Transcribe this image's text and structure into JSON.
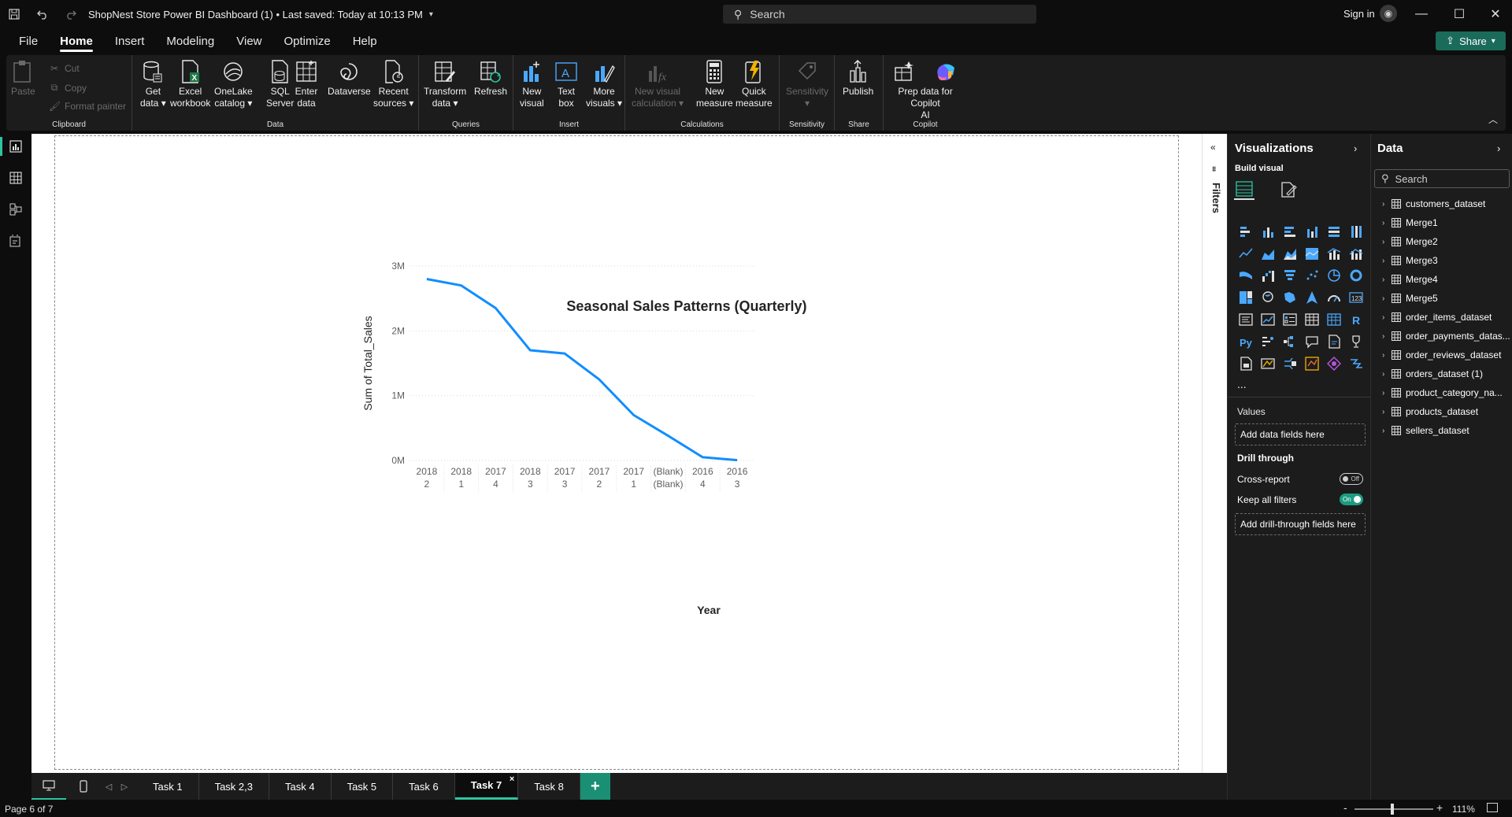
{
  "titlebar": {
    "title": "ShopNest Store Power BI Dashboard (1) • Last saved: Today at 10:13 PM",
    "search_placeholder": "Search",
    "signin": "Sign in"
  },
  "menu": {
    "tabs": [
      "File",
      "Home",
      "Insert",
      "Modeling",
      "View",
      "Optimize",
      "Help"
    ],
    "active": "Home",
    "share_label": "Share"
  },
  "ribbon": {
    "clipboard": {
      "label": "Clipboard",
      "paste": "Paste",
      "cut": "Cut",
      "copy": "Copy",
      "format_painter": "Format painter"
    },
    "data": {
      "label": "Data",
      "get_data": [
        "Get",
        "data"
      ],
      "excel": [
        "Excel",
        "workbook"
      ],
      "onelake": [
        "OneLake",
        "catalog"
      ],
      "sql": [
        "SQL",
        "Server"
      ],
      "enter": [
        "Enter",
        "data"
      ],
      "dataverse": [
        "Dataverse",
        ""
      ],
      "recent": [
        "Recent",
        "sources"
      ]
    },
    "queries": {
      "label": "Queries",
      "transform": [
        "Transform",
        "data"
      ],
      "refresh": [
        "Refresh",
        ""
      ]
    },
    "insert": {
      "label": "Insert",
      "new_visual": [
        "New",
        "visual"
      ],
      "text_box": [
        "Text",
        "box"
      ],
      "more_visuals": [
        "More",
        "visuals"
      ]
    },
    "calculations": {
      "label": "Calculations",
      "new_visual_calc": [
        "New visual",
        "calculation"
      ],
      "new_measure": [
        "New",
        "measure"
      ],
      "quick_measure": [
        "Quick",
        "measure"
      ]
    },
    "sensitivity": {
      "label": "Sensitivity",
      "sensitivity": [
        "Sensitivity",
        ""
      ]
    },
    "share": {
      "label": "Share",
      "publish": [
        "Publish",
        ""
      ]
    },
    "copilot": {
      "label": "Copilot",
      "prep": [
        "Prep data for Copilot",
        "AI"
      ]
    }
  },
  "chart_data": {
    "type": "line",
    "title": "Seasonal Sales Patterns (Quarterly)",
    "xlabel": "Year",
    "ylabel": "Sum of Total_Sales",
    "categories": [
      [
        "2018",
        "2"
      ],
      [
        "2018",
        "1"
      ],
      [
        "2017",
        "4"
      ],
      [
        "2018",
        "3"
      ],
      [
        "2017",
        "3"
      ],
      [
        "2017",
        "2"
      ],
      [
        "2017",
        "1"
      ],
      [
        "(Blank)",
        "(Blank)"
      ],
      [
        "2016",
        "4"
      ],
      [
        "2016",
        "3"
      ]
    ],
    "values": [
      2800000,
      2700000,
      2350000,
      1700000,
      1650000,
      1250000,
      700000,
      380000,
      50000,
      5000
    ],
    "yticks": [
      "0M",
      "1M",
      "2M",
      "3M"
    ],
    "ylim": [
      0,
      3000000
    ],
    "line_color": "#118DFF",
    "grid": true
  },
  "filters_label": "Filters",
  "visualizations": {
    "title": "Visualizations",
    "build_visual": "Build visual",
    "more": "...",
    "values_label": "Values",
    "values_placeholder": "Add data fields here",
    "drill_through": "Drill through",
    "cross_report": "Cross-report",
    "cross_report_state": "Off",
    "keep_all_filters": "Keep all filters",
    "keep_all_filters_state": "On",
    "drill_placeholder": "Add drill-through fields here"
  },
  "data_pane": {
    "title": "Data",
    "search_placeholder": "Search",
    "tables": [
      "customers_dataset",
      "Merge1",
      "Merge2",
      "Merge3",
      "Merge4",
      "Merge5",
      "order_items_dataset",
      "order_payments_datas...",
      "order_reviews_dataset",
      "orders_dataset (1)",
      "product_category_na...",
      "products_dataset",
      "sellers_dataset"
    ]
  },
  "page_tabs": {
    "tabs": [
      "Task 1",
      "Task 2,3",
      "Task 4",
      "Task 5",
      "Task 6",
      "Task 7",
      "Task 8"
    ],
    "active": "Task 7",
    "close": "×",
    "add": "+"
  },
  "status": {
    "page": "Page 6 of 7",
    "zoom": "111%"
  }
}
